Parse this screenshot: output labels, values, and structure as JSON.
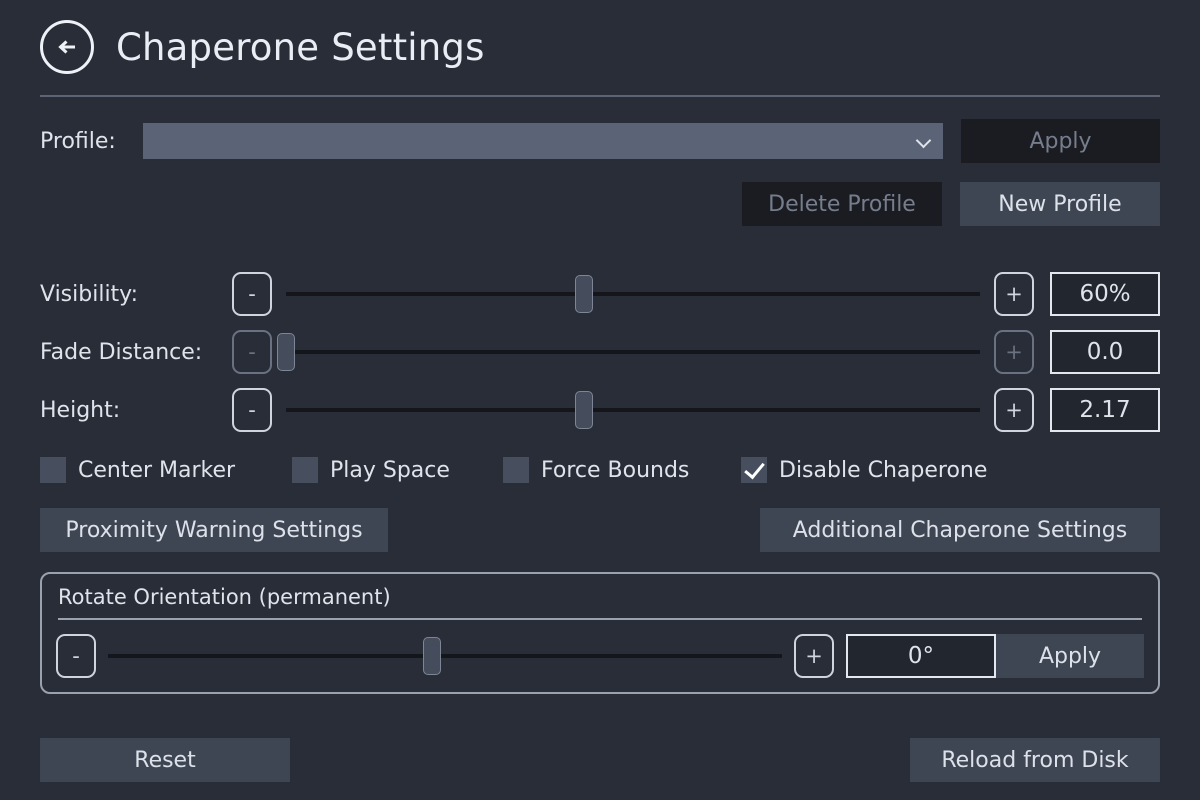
{
  "header": {
    "back_icon": "arrow-left-circle-icon",
    "title": "Chaperone Settings"
  },
  "profile": {
    "label": "Profile:",
    "selected_value": "",
    "chevron_icon": "chevron-down-icon",
    "apply_label": "Apply",
    "apply_enabled": false,
    "delete_label": "Delete Profile",
    "delete_enabled": false,
    "new_label": "New Profile",
    "new_enabled": true
  },
  "sliders": [
    {
      "label": "Visibility:",
      "minus_label": "-",
      "plus_label": "+",
      "enabled": true,
      "value": "60%",
      "fill_percent": 43
    },
    {
      "label": "Fade Distance:",
      "minus_label": "-",
      "plus_label": "+",
      "enabled": false,
      "value": "0.0",
      "fill_percent": 0
    },
    {
      "label": "Height:",
      "minus_label": "-",
      "plus_label": "+",
      "enabled": true,
      "value": "2.17",
      "fill_percent": 43
    }
  ],
  "checkboxes": [
    {
      "label": "Center Marker",
      "checked": false
    },
    {
      "label": "Play Space",
      "checked": false
    },
    {
      "label": "Force Bounds",
      "checked": false
    },
    {
      "label": "Disable Chaperone",
      "checked": true
    }
  ],
  "mid_buttons": {
    "proximity_label": "Proximity Warning Settings",
    "additional_label": "Additional Chaperone Settings"
  },
  "rotate": {
    "title": "Rotate Orientation (permanent)",
    "minus_label": "-",
    "plus_label": "+",
    "value": "0°",
    "fill_percent": 48,
    "apply_label": "Apply"
  },
  "bottom": {
    "reset_label": "Reset",
    "reload_label": "Reload from Disk"
  },
  "colors": {
    "background": "#282d38",
    "button": "#3e4654",
    "button_disabled": "#1a1c22",
    "dropdown": "#5b6377",
    "text": "#dfe3ea",
    "text_disabled": "#767d8c",
    "track": "#14161c",
    "thumb": "#454d5d"
  }
}
